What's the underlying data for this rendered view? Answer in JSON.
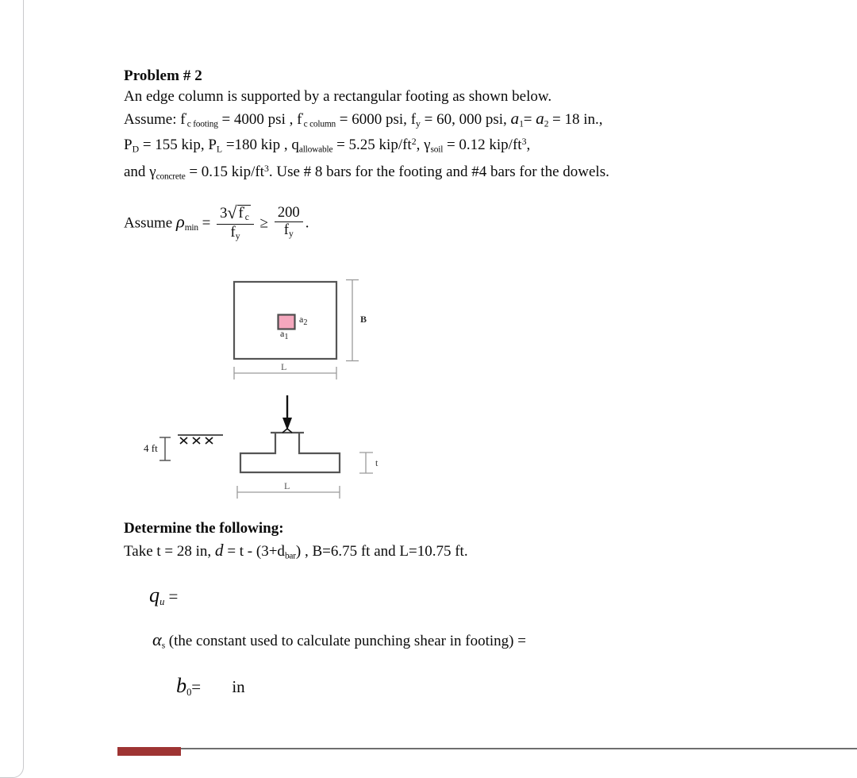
{
  "document": {
    "problem_title": "Problem # 2",
    "intro": "An edge column is supported by a rectangular footing as shown below.",
    "assume_prefix": "Assume:",
    "assume": {
      "fc_footing_label": "f",
      "fc_footing_sub": "c  footing",
      "fc_footing_value": "= 4000 psi ,",
      "fc_column_label": "f",
      "fc_column_sub": "c  column",
      "fc_column_value": "= 6000 psi,",
      "fy_label": "f",
      "fy_sub": "y",
      "fy_value": "= 60, 000 psi,",
      "a1_label": "a",
      "a1_sub": "1",
      "a_eq": "=",
      "a2_label": "a",
      "a2_sub": "2",
      "a_value": "= 18 in.,"
    },
    "loads": {
      "pd_label": "P",
      "pd_sub": "D",
      "pd_value": "= 155  kip,",
      "pl_label": "P",
      "pl_sub": "L",
      "pl_value": "=180  kip ,",
      "q_label": "q",
      "q_sub": "allowable",
      "q_value": "= 5.25  kip/ft",
      "q_exp": "2",
      "q_tail": ",",
      "gamma_soil_label": "γ",
      "gamma_soil_sub": "soil",
      "gamma_soil_value": "= 0.12 kip/ft",
      "gamma_soil_exp": "3",
      "gamma_soil_tail": ","
    },
    "gamma_line": {
      "prefix": "and",
      "gamma_label": "γ",
      "gamma_sub": "concrete",
      "gamma_value": "= 0.15 kip/ft",
      "gamma_exp": "3",
      "tail": ". Use # 8 bars for the footing and #4 bars for the dowels."
    },
    "rho_line": {
      "prefix": "Assume",
      "rho_symbol": "ρ",
      "rho_sub": "min",
      "equals": "=",
      "num_coeff": "3",
      "num_radicand": "f",
      "num_radicand_sub": "c",
      "num_radicand_prime": "'",
      "den": "f",
      "den_sub": "y",
      "relation": "≥",
      "rhs_num": "200",
      "rhs_den": "f",
      "rhs_den_sub": "y",
      "period": "."
    },
    "determine_heading": "Determine the following:",
    "take_line": {
      "prefix": "Take t = 28 in,",
      "d_symbol": "d",
      "d_expr": "= t - (3+d",
      "d_sub": "bar",
      "d_close": ") ,",
      "tail": "B=6.75 ft and L=10.75 ft."
    },
    "answers": [
      {
        "symbol": "q",
        "sub": "u",
        "text": "=",
        "unit": ""
      },
      {
        "symbol": "α",
        "sub": "s",
        "text": "(the constant used to calculate punching shear in footing) =",
        "unit": ""
      },
      {
        "symbol": "b",
        "sub": "0",
        "text": "=",
        "unit": "in"
      }
    ]
  },
  "figure": {
    "plan_view": {
      "column_label_a1": "a",
      "column_label_a1_sub": "1",
      "column_label_a2": "a",
      "column_label_a2_sub": "2",
      "width_label": "L",
      "height_label": "B",
      "column_fill": "#f4a7bd",
      "column_stroke": "#4d4d4d",
      "footing_stroke": "#555555",
      "dimension_color": "#9a9a9a"
    },
    "elevation_view": {
      "depth_label": "4 ft",
      "thickness_label": "t",
      "width_label": "L",
      "load_arrow": "downward-load-arrow",
      "ground_symbol": "ground-hatch"
    }
  },
  "chrome": {
    "progress_color": "#9e3433",
    "rule_color": "#6f6f6f"
  }
}
